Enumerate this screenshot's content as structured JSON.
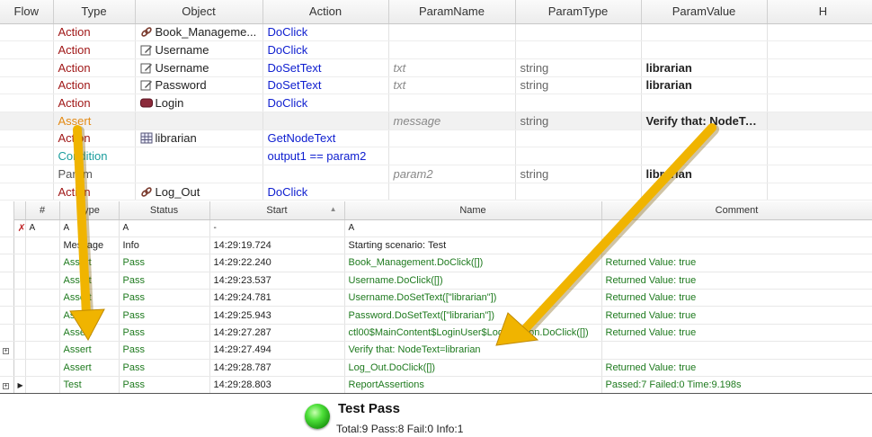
{
  "steps": {
    "headers": [
      "Flow",
      "Type",
      "Object",
      "Action",
      "ParamName",
      "ParamType",
      "ParamValue",
      "H"
    ],
    "rows": [
      {
        "flow": "",
        "type": "Action",
        "type_kind": "action",
        "object": "Book_Manageme...",
        "object_icon": "link-icon",
        "action": "DoClick",
        "param_name": "",
        "param_type": "",
        "param_value": ""
      },
      {
        "flow": "",
        "type": "Action",
        "type_kind": "action",
        "object": "Username",
        "object_icon": "edit-icon",
        "action": "DoClick",
        "param_name": "",
        "param_type": "",
        "param_value": ""
      },
      {
        "flow": "",
        "type": "Action",
        "type_kind": "action",
        "object": "Username",
        "object_icon": "edit-icon",
        "action": "DoSetText",
        "param_name": "txt",
        "param_type": "string",
        "param_value": "librarian"
      },
      {
        "flow": "",
        "type": "Action",
        "type_kind": "action",
        "object": "Password",
        "object_icon": "edit-icon",
        "action": "DoSetText",
        "param_name": "txt",
        "param_type": "string",
        "param_value": "librarian"
      },
      {
        "flow": "",
        "type": "Action",
        "type_kind": "action",
        "object": "Login",
        "object_icon": "button-icon",
        "action": "DoClick",
        "param_name": "",
        "param_type": "",
        "param_value": ""
      },
      {
        "flow": "",
        "type": "Assert",
        "type_kind": "assert",
        "object": "",
        "object_icon": "",
        "action": "",
        "param_name": "message",
        "param_type": "string",
        "param_value": "Verify that: NodeText=librarian"
      },
      {
        "flow": "",
        "type": "Action",
        "type_kind": "action",
        "object": "librarian",
        "object_icon": "table-icon",
        "action": "GetNodeText",
        "param_name": "",
        "param_type": "",
        "param_value": ""
      },
      {
        "flow": "",
        "type": "Condition",
        "type_kind": "condition",
        "object": "",
        "object_icon": "",
        "action": "output1 == param2",
        "param_name": "",
        "param_type": "",
        "param_value": ""
      },
      {
        "flow": "",
        "type": "Param",
        "type_kind": "param",
        "object": "",
        "object_icon": "",
        "action": "",
        "param_name": "param2",
        "param_type": "string",
        "param_value": "librarian"
      },
      {
        "flow": "",
        "type": "Action",
        "type_kind": "action",
        "object": "Log_Out",
        "object_icon": "link-icon",
        "action": "DoClick",
        "param_name": "",
        "param_type": "",
        "param_value": ""
      }
    ]
  },
  "results": {
    "headers": [
      "#",
      "Type",
      "Status",
      "Start",
      "Name",
      "Comment"
    ],
    "filter_row": [
      "A",
      "A",
      "A",
      "-",
      "A",
      ""
    ],
    "rows": [
      {
        "type": "Message",
        "status": "Info",
        "start": "14:29:19.724",
        "name": "Starting scenario: Test",
        "comment": ""
      },
      {
        "type": "Assert",
        "status": "Pass",
        "start": "14:29:22.240",
        "name": "Book_Management.DoClick([])",
        "comment": "Returned Value: true"
      },
      {
        "type": "Assert",
        "status": "Pass",
        "start": "14:29:23.537",
        "name": "Username.DoClick([])",
        "comment": "Returned Value: true"
      },
      {
        "type": "Assert",
        "status": "Pass",
        "start": "14:29:24.781",
        "name": "Username.DoSetText([\"librarian\"])",
        "comment": "Returned Value: true"
      },
      {
        "type": "Assert",
        "status": "Pass",
        "start": "14:29:25.943",
        "name": "Password.DoSetText([\"librarian\"])",
        "comment": "Returned Value: true"
      },
      {
        "type": "Assert",
        "status": "Pass",
        "start": "14:29:27.287",
        "name": "ctl00$MainContent$LoginUser$LoginButton.DoClick([])",
        "comment": "Returned Value: true"
      },
      {
        "type": "Assert",
        "status": "Pass",
        "start": "14:29:27.494",
        "name": "Verify that: NodeText=librarian",
        "comment": ""
      },
      {
        "type": "Assert",
        "status": "Pass",
        "start": "14:29:28.787",
        "name": "Log_Out.DoClick([])",
        "comment": "Returned Value: true"
      },
      {
        "type": "Test",
        "status": "Pass",
        "start": "14:29:28.803",
        "name": "ReportAssertions",
        "comment": "Passed:7 Failed:0 Time:9.198s"
      }
    ]
  },
  "summary": {
    "title": "Test Pass",
    "details": "Total:9 Pass:8 Fail:0 Info:1",
    "status_color": "#3ccf2a"
  },
  "colors": {
    "action": "#a01818",
    "assert": "#e38a14",
    "condition": "#1a9d9d",
    "pass_green": "#1e7a1e",
    "arrow": "#f0b400"
  }
}
